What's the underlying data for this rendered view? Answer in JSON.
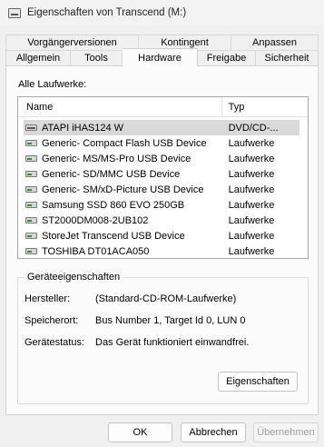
{
  "window": {
    "title": "Eigenschaften von Transcend (M:)"
  },
  "tabs": {
    "row1": [
      "Vorgängerversionen",
      "Kontingent",
      "Anpassen"
    ],
    "row2": [
      "Allgemein",
      "Tools",
      "Hardware",
      "Freigabe",
      "Sicherheit"
    ],
    "active": "Hardware"
  },
  "drives_section": {
    "label": "Alle Laufwerke:",
    "columns": {
      "name": "Name",
      "type": "Typ"
    },
    "rows": [
      {
        "name": "ATAPI iHAS124   W",
        "type": "DVD/CD-...",
        "icon": "optical-drive-icon",
        "selected": true
      },
      {
        "name": "Generic- Compact Flash USB Device",
        "type": "Laufwerke",
        "icon": "drive-icon"
      },
      {
        "name": "Generic- MS/MS-Pro USB Device",
        "type": "Laufwerke",
        "icon": "drive-icon"
      },
      {
        "name": "Generic- SD/MMC USB Device",
        "type": "Laufwerke",
        "icon": "drive-icon"
      },
      {
        "name": "Generic- SM/xD-Picture USB Device",
        "type": "Laufwerke",
        "icon": "drive-icon"
      },
      {
        "name": "Samsung SSD 860 EVO 250GB",
        "type": "Laufwerke",
        "icon": "drive-icon"
      },
      {
        "name": "ST2000DM008-2UB102",
        "type": "Laufwerke",
        "icon": "drive-icon"
      },
      {
        "name": "StoreJet Transcend USB Device",
        "type": "Laufwerke",
        "icon": "drive-icon"
      },
      {
        "name": "TOSHIBA DT01ACA050",
        "type": "Laufwerke",
        "icon": "drive-icon"
      }
    ]
  },
  "device_properties": {
    "title": "Geräteeigenschaften",
    "manufacturer_label": "Hersteller:",
    "manufacturer_value": "(Standard-CD-ROM-Laufwerke)",
    "location_label": "Speicherort:",
    "location_value": "Bus Number 1, Target Id 0, LUN 0",
    "status_label": "Gerätestatus:",
    "status_value": "Das Gerät funktioniert einwandfrei.",
    "properties_button": "Eigenschaften"
  },
  "footer": {
    "ok": "OK",
    "cancel": "Abbrechen",
    "apply": "Übernehmen"
  }
}
